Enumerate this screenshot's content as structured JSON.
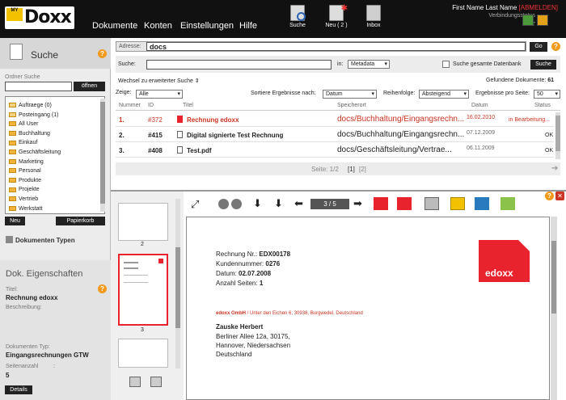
{
  "topbar": {
    "logo_badge": "MY",
    "logo_text": "Doxx",
    "menu": [
      "Dokumente",
      "Konten",
      "Einstellungen",
      "Hilfe"
    ],
    "toolbar": [
      {
        "label": "Suche",
        "icon": "search-icon"
      },
      {
        "label": "Neu ( 2 )",
        "icon": "new-document-icon"
      },
      {
        "label": "Inbox",
        "icon": "inbox-icon"
      }
    ],
    "user_name": "First Name Last Name",
    "logout": "[ABMELDEN]",
    "conn_label": "Verbindungsstatus",
    "conn_value": "GUT"
  },
  "left": {
    "title": "Suche",
    "folder_label": "Ordner Suche",
    "open_btn": "öffnen",
    "folders": [
      "Auftraege (0)",
      "Posteingang (1)",
      "All User",
      "Buchhaltung",
      "Einkauf",
      "Geschäftsleitung",
      "Marketing",
      "Personal",
      "Produkte",
      "Projekte",
      "Vertrieb",
      "Werkstatt"
    ],
    "new_btn": "Neu",
    "trash_btn": "Papierkorb",
    "doc_types": "Dokumenten Typen",
    "props_title": "Dok. Eigenschaften",
    "title_label": "Titel:",
    "title_value": "Rechnung edoxx",
    "desc_label": "Beschreibung:",
    "doctype_label": "Dokumenten Typ:",
    "doctype_value": "Eingangsrechnungen GTW",
    "pages_label": "Seitenanzahl",
    "pages_colon": ":",
    "pages_value": "5",
    "details_btn": "Details"
  },
  "search": {
    "address_label": "Adresse:",
    "address_value": "docs",
    "go_btn": "Go",
    "search_label": "Suche:",
    "in_label": "in:",
    "in_value": "Metadata",
    "db_label": "Suche gesamte Datenbank",
    "search_btn": "Suche",
    "extended": "Wechsel zu erweiterter Suche ⇕",
    "found_label": "Gefundene Dokumente:",
    "found_value": "61",
    "show_label": "Zeige:",
    "show_value": "Alle",
    "sort_label": "Sortiere Ergebnisse nach:",
    "sort_value": "Datum",
    "order_label": "Reihenfolge:",
    "order_value": "Absteigend",
    "perpage_label": "Ergebnisse pro Seite:",
    "perpage_value": "50"
  },
  "table": {
    "headers": [
      "Nummer",
      "ID",
      "Titel",
      "Speicherort",
      "Datum",
      "Status"
    ],
    "rows": [
      {
        "num": "1.",
        "id": "#372",
        "title": "Rechnung edoxx",
        "loc": "docs/Buchhaltung/Eingangsrechn...",
        "date": "16.02.2010",
        "status": "in Bearbeitung..."
      },
      {
        "num": "2.",
        "id": "#415",
        "title": "Digital signierte Test Rechnung",
        "loc": "docs/Buchhaltung/Eingangsrechn...",
        "date": "07.12.2009",
        "status": "OK"
      },
      {
        "num": "3.",
        "id": "#408",
        "title": "Test.pdf",
        "loc": "docs/Geschäftsleitung/Vertrae...",
        "date": "06.11.2009",
        "status": "OK"
      }
    ]
  },
  "pager": {
    "label": "Seite: 1/2",
    "current": "[1]",
    "next": "[2]"
  },
  "viewer": {
    "page_counter": "3 / 5",
    "thumb_labels": [
      "2",
      "3"
    ],
    "doc": {
      "line1_label": "Rechnung Nr.:",
      "line1_value": "EDX00178",
      "line2_label": "Kundennummer:",
      "line2_value": "0276",
      "line3_label": "Datum:",
      "line3_value": "02.07.2008",
      "line4_label": "Anzahl Seiten:",
      "line4_value": "1",
      "sender_name": "edoxx GmbH",
      "sender_rest": " / Unter den Eichen 6, 30938, Burgwedel, Deutschland",
      "recipient": [
        "Zauske Herbert",
        "Berliner Allee 12a, 30175,",
        "Hannover, Niedersachsen",
        "Deutschland"
      ],
      "logo_text": "edoxx"
    }
  },
  "colors": {
    "accent_red": "#c32",
    "logo_red": "#e8232d",
    "help_orange": "#f39a1c"
  }
}
